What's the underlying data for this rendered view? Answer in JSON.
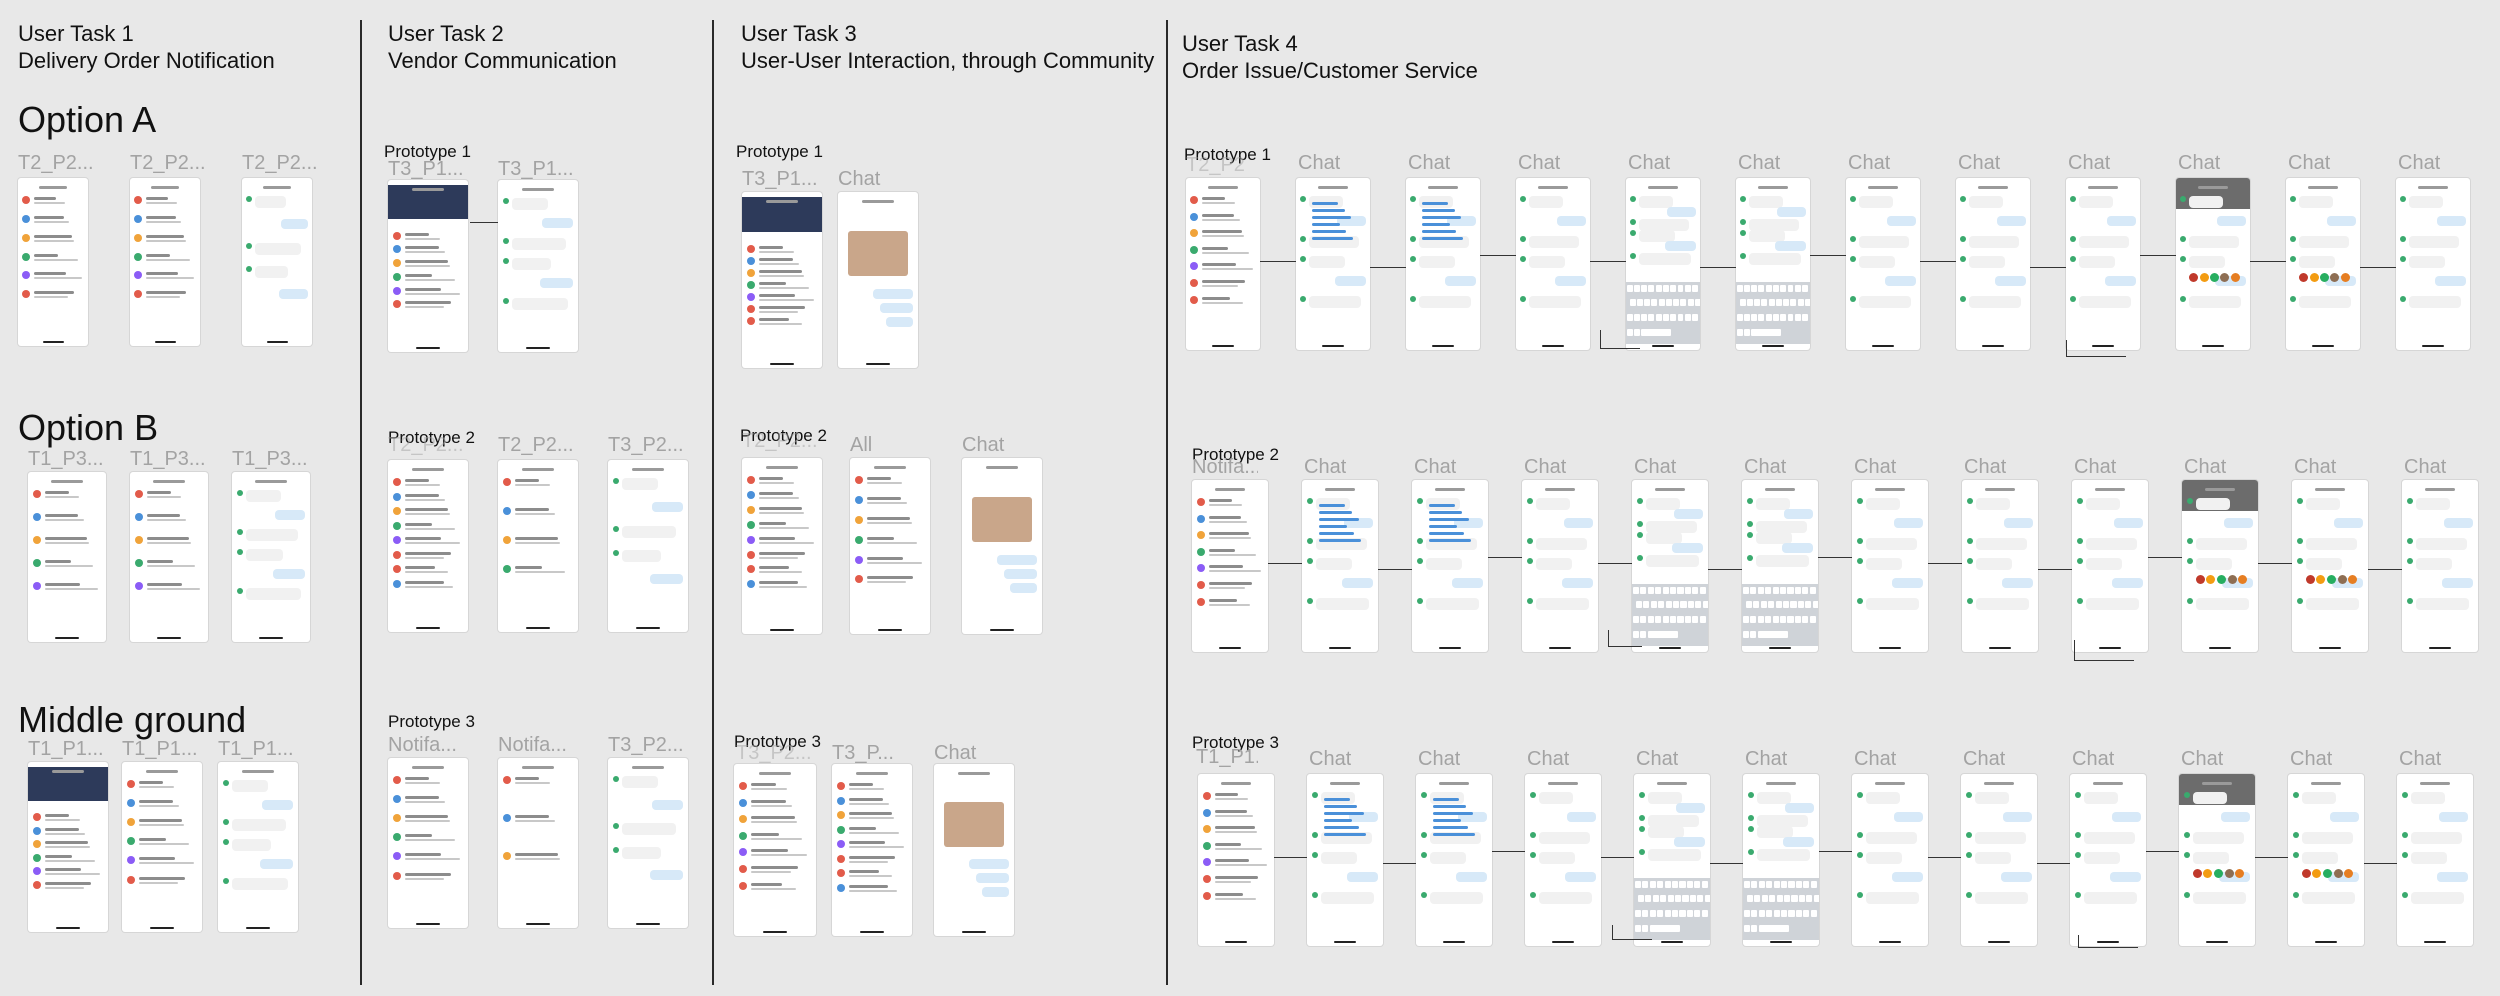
{
  "tasks": [
    {
      "title_line1": "User Task 1",
      "title_line2": "Delivery Order Notification"
    },
    {
      "title_line1": "User Task 2",
      "title_line2": "Vendor Communication"
    },
    {
      "title_line1": "User Task 3",
      "title_line2": "User-User Interaction, through Community"
    },
    {
      "title_line1": "User Task 4",
      "title_line2": "Order Issue/Customer Service"
    }
  ],
  "task1": {
    "options": [
      "Option A",
      "Option B",
      "Middle ground"
    ],
    "option_a_labels": [
      "T2_P2...",
      "T2_P2...",
      "T2_P2..."
    ],
    "option_b_labels": [
      "T1_P3...",
      "T1_P3...",
      "T1_P3..."
    ],
    "middle_labels": [
      "T1_P1...",
      "T1_P1...",
      "T1_P1..."
    ]
  },
  "task2": {
    "prototypes": [
      "Prototype 1",
      "Prototype 2",
      "Prototype 3"
    ],
    "p1_labels": [
      "T3_P1...",
      "T3_P1..."
    ],
    "p2_labels": [
      "T2_P2...",
      "T2_P2...",
      "T3_P2..."
    ],
    "p3_labels": [
      "Notifa...",
      "Notifa...",
      "T3_P2..."
    ]
  },
  "task3": {
    "prototypes": [
      "Prototype 1",
      "Prototype 2",
      "Prototype 3"
    ],
    "p1_labels": [
      "T3_P1...",
      "Chat"
    ],
    "p2_labels": [
      "T2_P2...",
      "All",
      "Chat"
    ],
    "p3_labels": [
      "T3_P2...",
      "T3_P...",
      "Chat"
    ]
  },
  "task4": {
    "prototypes": [
      "Prototype 1",
      "Prototype 2",
      "Prototype 3"
    ],
    "p1_first_label": "T2_P2...",
    "p2_first_label": "Notifa...",
    "p3_first_label": "T1_P1...",
    "chat_label": "Chat"
  },
  "colors": {
    "background": "#e8e8e8",
    "divider": "#2a2a2a",
    "label_gray": "#a3a3a3",
    "accent_blue": "#4a90d9",
    "navy_header": "#2d3a5a"
  }
}
